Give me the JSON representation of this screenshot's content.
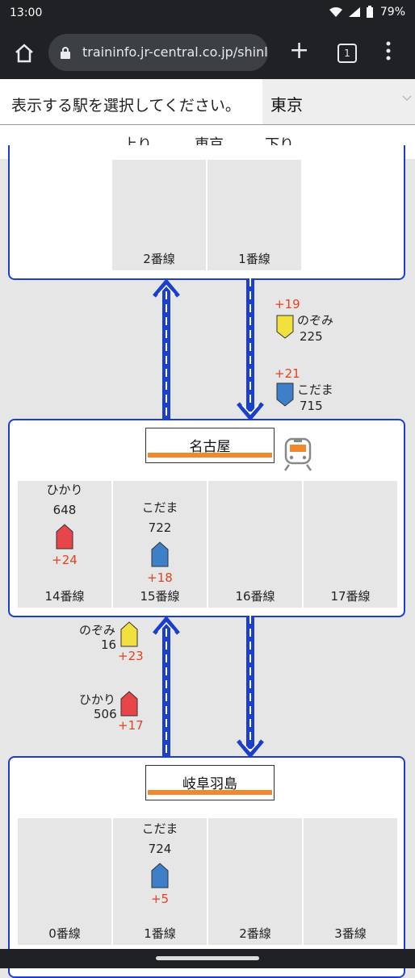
{
  "status": {
    "time": "13:00",
    "battery": "79%"
  },
  "browser": {
    "url": "traininfo.jr-central.co.jp/shinl",
    "tab_count": "1"
  },
  "selector": {
    "prompt": "表示する駅を選択してください。",
    "selected": "東京"
  },
  "direction": {
    "up": "上り",
    "station": "東京",
    "down": "下り"
  },
  "tokyo": {
    "tracks": [
      "2番線",
      "1番線"
    ]
  },
  "between1": {
    "down_trains": [
      {
        "type": "のぞみ",
        "number": "225",
        "delay": "+19",
        "color": "#f2e03c"
      },
      {
        "type": "こだま",
        "number": "715",
        "delay": "+21",
        "color": "#3d7fc8"
      }
    ]
  },
  "nagoya": {
    "name": "名古屋",
    "tracks": [
      "14番線",
      "15番線",
      "16番線",
      "17番線"
    ],
    "trains": [
      {
        "type": "ひかり",
        "number": "648",
        "delay": "+24",
        "color": "#e8454a"
      },
      {
        "type": "こだま",
        "number": "722",
        "delay": "+18",
        "color": "#3d7fc8"
      }
    ]
  },
  "between2": {
    "up_trains": [
      {
        "type": "のぞみ",
        "number": "16",
        "delay": "+23",
        "color": "#f2e03c"
      },
      {
        "type": "ひかり",
        "number": "506",
        "delay": "+17",
        "color": "#e8454a"
      }
    ]
  },
  "gifuhashima": {
    "name": "岐阜羽島",
    "tracks": [
      "0番線",
      "1番線",
      "2番線",
      "3番線"
    ],
    "trains": [
      {
        "type": "こだま",
        "number": "724",
        "delay": "+5",
        "color": "#3d7fc8"
      }
    ]
  },
  "icons": [
    "home-icon",
    "lock-icon",
    "plus-icon",
    "tabs-icon",
    "menu-icon",
    "train-icon",
    "wifi-icon",
    "signal-icon",
    "battery-icon"
  ]
}
